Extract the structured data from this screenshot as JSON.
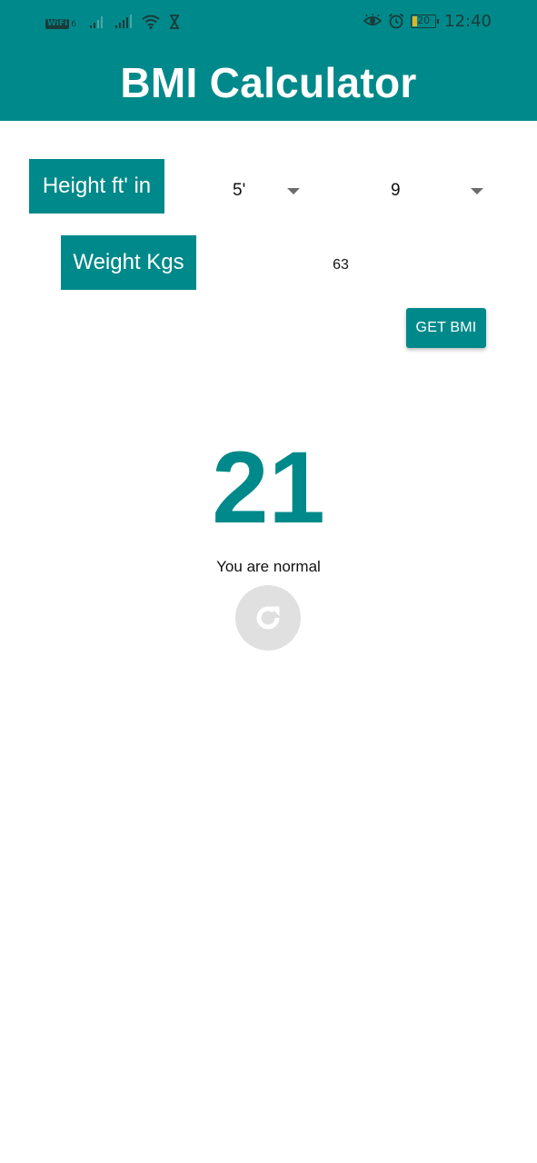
{
  "status_bar": {
    "wifi_badge": "WiFi",
    "wifi_badge_sub": "6",
    "battery_level": "20",
    "time": "12:40",
    "icons": [
      "wifi-calling-icon",
      "signal-icon",
      "signal-icon",
      "wifi-icon",
      "hourglass-icon",
      "eye-comfort-icon",
      "alarm-icon",
      "battery-icon"
    ]
  },
  "app_bar": {
    "title": "BMI Calculator"
  },
  "height": {
    "label": "Height ft' in",
    "feet_value": "5'",
    "inches_value": "9"
  },
  "weight": {
    "label": "Weight Kgs",
    "value": "63"
  },
  "actions": {
    "get_bmi_label": "GET BMI",
    "refresh_icon": "refresh-icon"
  },
  "result": {
    "bmi": "21",
    "message": "You are normal"
  },
  "colors": {
    "primary": "#00898a",
    "status_text": "#1b3a3a",
    "refresh_bg": "#e0e0e0",
    "battery_fill": "#e3b224"
  }
}
